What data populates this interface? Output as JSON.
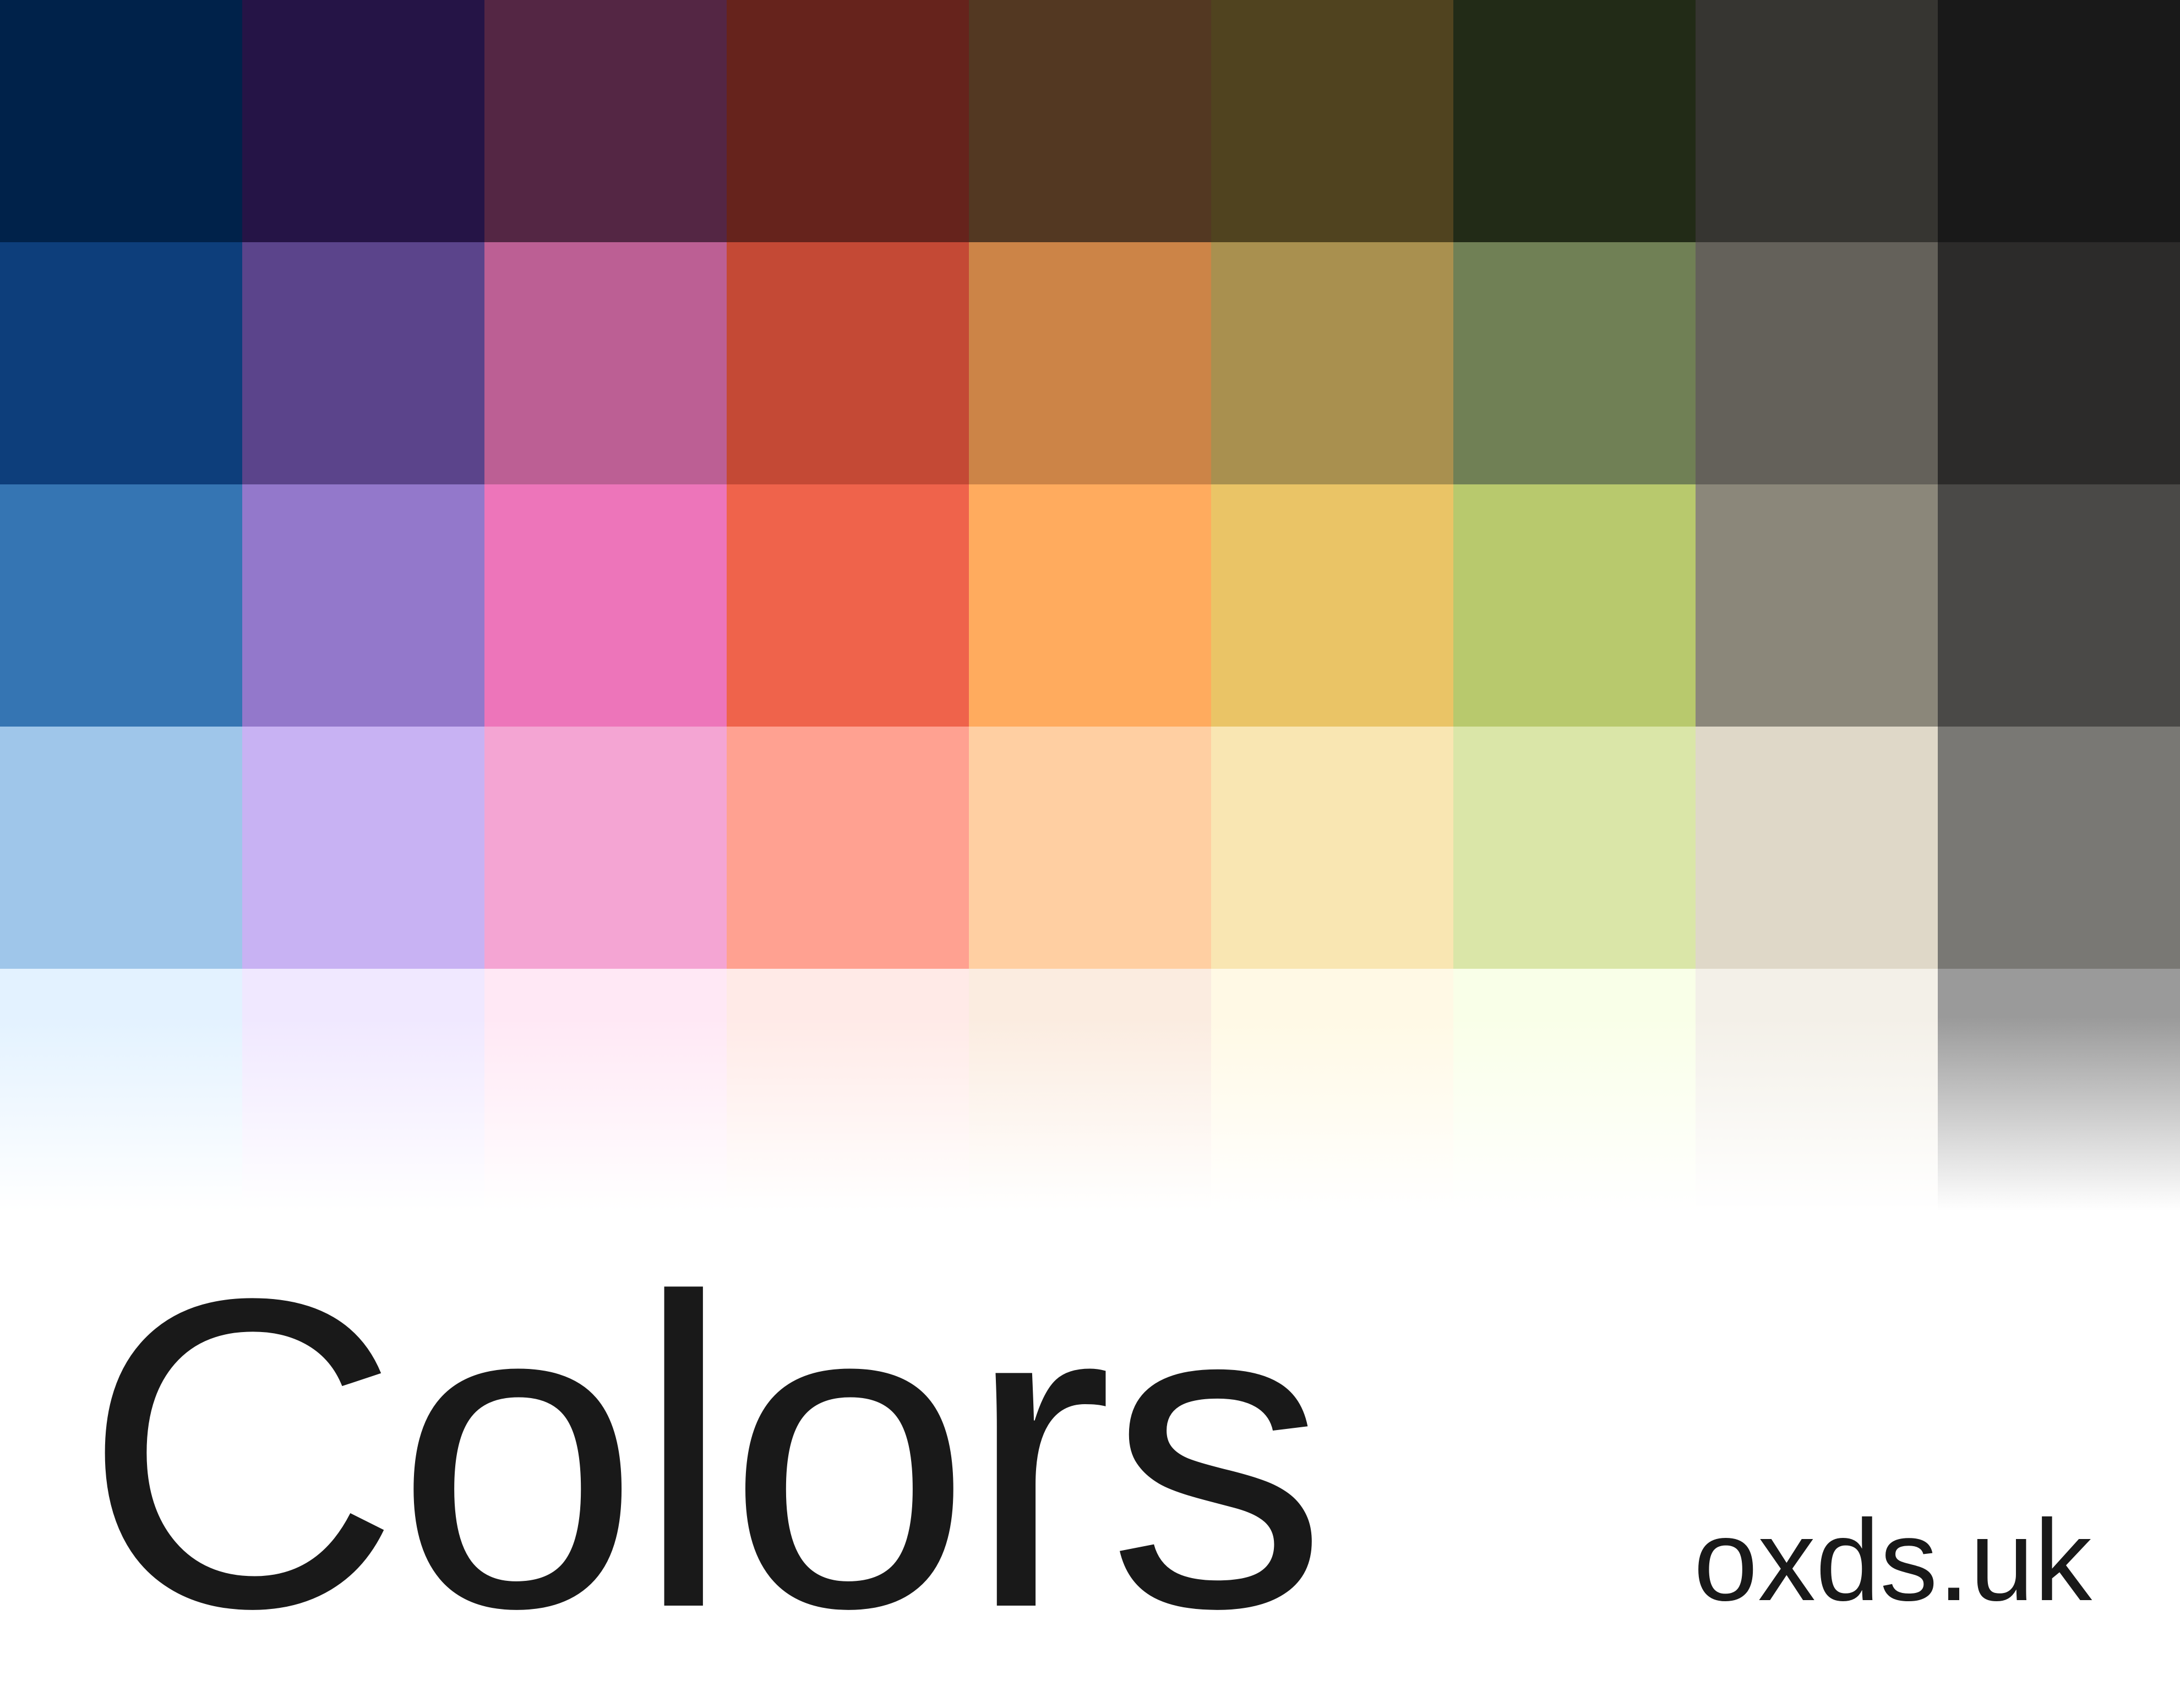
{
  "title": "Colors",
  "site": "oxds.uk",
  "palette": {
    "rows": [
      [
        "#00224a",
        "#251446",
        "#542644",
        "#66231c",
        "#533822",
        "#50431f",
        "#222b17",
        "#363531",
        "#191919"
      ],
      [
        "#0d3e7b",
        "#5b448b",
        "#bc5f94",
        "#c44935",
        "#cc8447",
        "#a9904f",
        "#708055",
        "#64615a",
        "#2c2b2a"
      ],
      [
        "#3575b3",
        "#9378cb",
        "#ed75ba",
        "#ef634b",
        "#ffab5e",
        "#eac466",
        "#b8c96d",
        "#8b877a",
        "#4a4947"
      ],
      [
        "#9fc6ea",
        "#c8b2f3",
        "#f4a5d3",
        "#ffa191",
        "#ffcfa2",
        "#f9e6b2",
        "#dae6a8",
        "#dfd8c8",
        "#797874"
      ],
      [
        "#e3f2ff",
        "#f0e8ff",
        "#ffe8f5",
        "#ffeae7",
        "#fbece0",
        "#fff9e5",
        "#f9ffe8",
        "#f3f0e8",
        "#9a9a9a"
      ]
    ]
  }
}
